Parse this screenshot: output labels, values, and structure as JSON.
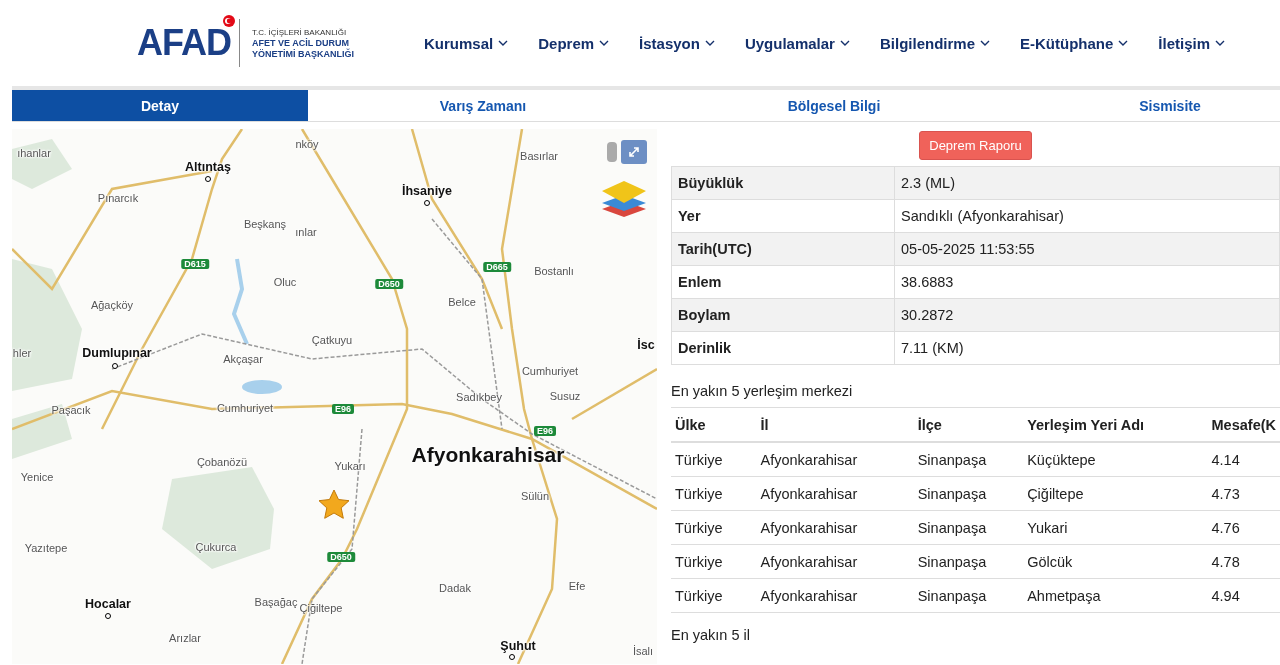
{
  "logo": {
    "mark": "AFAD",
    "lines": [
      "T.C. İÇİŞLERİ BAKANLIĞI",
      "AFET VE ACİL DURUM",
      "YÖNETİMİ BAŞKANLIĞI"
    ]
  },
  "nav": [
    "Kurumsal",
    "Deprem",
    "İstasyon",
    "Uygulamalar",
    "Bilgilendirme",
    "E-Kütüphane",
    "İletişim"
  ],
  "tabs": [
    {
      "label": "Detay",
      "selected": true
    },
    {
      "label": "Varış Zamanı",
      "selected": false
    },
    {
      "label": "Bölgesel Bilgi",
      "selected": false
    },
    {
      "label": "Sismisite",
      "selected": false
    }
  ],
  "map": {
    "labels": [
      {
        "text": "Altıntaş",
        "kind": "major"
      },
      {
        "text": "İhsaniye",
        "kind": "major"
      },
      {
        "text": "Dumlupınar",
        "kind": "major"
      },
      {
        "text": "Afyonkarahisar",
        "kind": "city"
      },
      {
        "text": "Hocalar",
        "kind": "major"
      },
      {
        "text": "Şuhut",
        "kind": "major"
      },
      {
        "text": "İsc",
        "kind": "major"
      },
      {
        "text": "ıhanlar",
        "kind": "minor"
      },
      {
        "text": "Pınarcık",
        "kind": "minor"
      },
      {
        "text": "nköy",
        "kind": "minor"
      },
      {
        "text": "Beşkanş",
        "kind": "minor"
      },
      {
        "text": "ınlar",
        "kind": "minor"
      },
      {
        "text": "Oluc",
        "kind": "minor"
      },
      {
        "text": "Ağaçköy",
        "kind": "minor"
      },
      {
        "text": "Çatkuyu",
        "kind": "minor"
      },
      {
        "text": "Akçaşar",
        "kind": "minor"
      },
      {
        "text": "hler",
        "kind": "minor"
      },
      {
        "text": "Basırlar",
        "kind": "minor"
      },
      {
        "text": "Bostanlı",
        "kind": "minor"
      },
      {
        "text": "Belce",
        "kind": "minor"
      },
      {
        "text": "Cumhuriyet",
        "kind": "minor"
      },
      {
        "text": "Cumhuriyet",
        "kind": "minor"
      },
      {
        "text": "Sadıkbey",
        "kind": "minor"
      },
      {
        "text": "Susuz",
        "kind": "minor"
      },
      {
        "text": "Paşacık",
        "kind": "minor"
      },
      {
        "text": "Çobanözü",
        "kind": "minor"
      },
      {
        "text": "Yukarı",
        "kind": "minor"
      },
      {
        "text": "Yenice",
        "kind": "minor"
      },
      {
        "text": "Sülün",
        "kind": "minor"
      },
      {
        "text": "Yazıtepe",
        "kind": "minor"
      },
      {
        "text": "Çukurca",
        "kind": "minor"
      },
      {
        "text": "Dadak",
        "kind": "minor"
      },
      {
        "text": "Efe",
        "kind": "minor"
      },
      {
        "text": "Başağaç",
        "kind": "minor"
      },
      {
        "text": "Çiğiltepe",
        "kind": "minor"
      },
      {
        "text": "Arızlar",
        "kind": "minor"
      },
      {
        "text": "İsalı",
        "kind": "minor"
      },
      {
        "text": "D615",
        "kind": "road"
      },
      {
        "text": "D650",
        "kind": "road"
      },
      {
        "text": "D665",
        "kind": "road"
      },
      {
        "text": "E96",
        "kind": "road"
      },
      {
        "text": "E96",
        "kind": "road"
      },
      {
        "text": "D650",
        "kind": "road"
      }
    ]
  },
  "report_button": "Deprem Raporu",
  "details": [
    {
      "label": "Büyüklük",
      "value": "2.3 (ML)"
    },
    {
      "label": "Yer",
      "value": "Sandıklı (Afyonkarahisar)"
    },
    {
      "label": "Tarih(UTC)",
      "value": "05-05-2025 11:53:55"
    },
    {
      "label": "Enlem",
      "value": "38.6883"
    },
    {
      "label": "Boylam",
      "value": "30.2872"
    },
    {
      "label": "Derinlik",
      "value": "7.11 (KM)"
    }
  ],
  "nearest_settlements": {
    "title": "En yakın 5 yerleşim merkezi",
    "columns": [
      "Ülke",
      "İl",
      "İlçe",
      "Yerleşim Yeri Adı",
      "Mesafe(K"
    ],
    "rows": [
      [
        "Türkiye",
        "Afyonkarahisar",
        "Sinanpaşa",
        "Küçüktepe",
        "4.14"
      ],
      [
        "Türkiye",
        "Afyonkarahisar",
        "Sinanpaşa",
        "Çiğiltepe",
        "4.73"
      ],
      [
        "Türkiye",
        "Afyonkarahisar",
        "Sinanpaşa",
        "Yukari",
        "4.76"
      ],
      [
        "Türkiye",
        "Afyonkarahisar",
        "Sinanpaşa",
        "Gölcük",
        "4.78"
      ],
      [
        "Türkiye",
        "Afyonkarahisar",
        "Sinanpaşa",
        "Ahmetpaşa",
        "4.94"
      ]
    ]
  },
  "nearest_provinces": {
    "title": "En yakın 5 il"
  }
}
